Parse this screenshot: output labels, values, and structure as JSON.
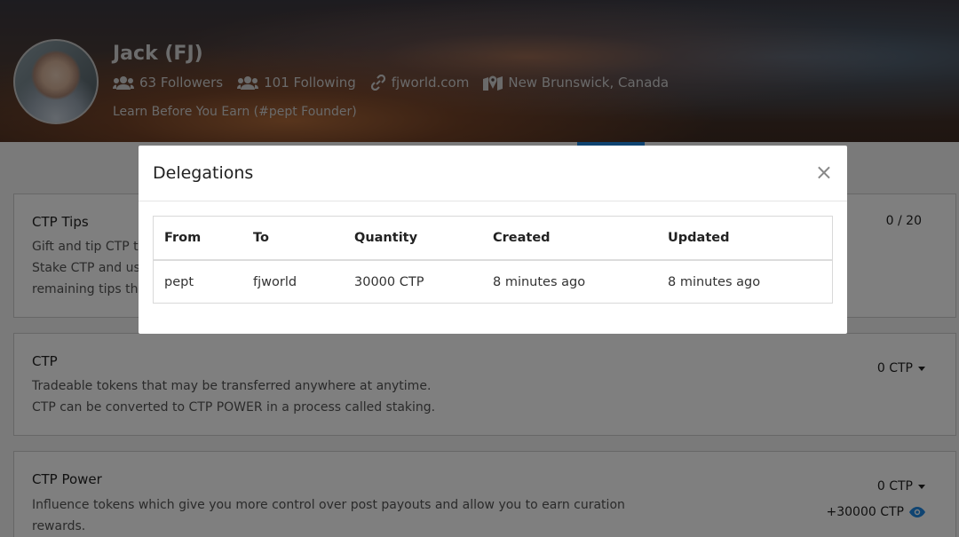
{
  "profile": {
    "name": "Jack (FJ)",
    "followers": "63 Followers",
    "following": "101 Following",
    "website": "fjworld.com",
    "location": "New Brunswick, Canada",
    "bio": "Learn Before You Earn (#pept Founder)"
  },
  "cards": {
    "tips": {
      "title": "CTP Tips",
      "desc_line1": "Gift and tip CTP t",
      "desc_line2": "Stake CTP and us",
      "desc_line3": "remaining tips th",
      "value": "0 / 20"
    },
    "ctp": {
      "title": "CTP",
      "desc_line1": "Tradeable tokens that may be transferred anywhere at anytime.",
      "desc_line2": "CTP can be converted to CTP POWER in a process called staking.",
      "value": "0 CTP"
    },
    "power": {
      "title": "CTP Power",
      "desc_line1": "Influence tokens which give you more control over post payouts and allow you to earn curation",
      "desc_line2": "rewards.",
      "value": "0 CTP",
      "delegated": "+30000 CTP"
    }
  },
  "modal": {
    "title": "Delegations",
    "close": "×",
    "columns": [
      "From",
      "To",
      "Quantity",
      "Created",
      "Updated"
    ],
    "rows": [
      [
        "pept",
        "fjworld",
        "30000 CTP",
        "8 minutes ago",
        "8 minutes ago"
      ]
    ]
  },
  "colors": {
    "accent": "#1e88e5"
  }
}
